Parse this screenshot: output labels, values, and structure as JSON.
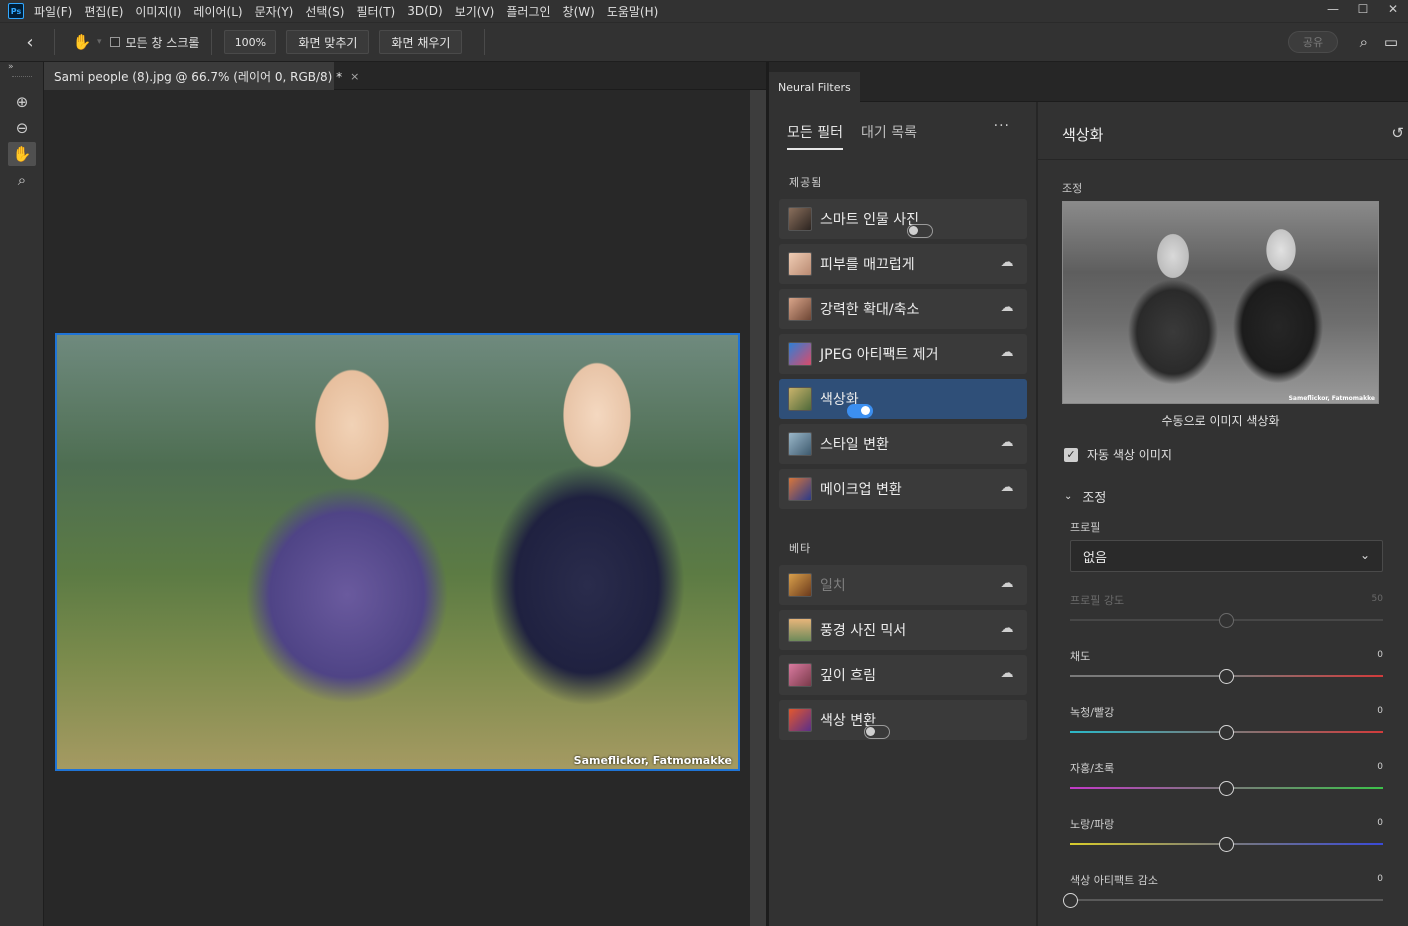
{
  "menubar": {
    "logo": "Ps",
    "items": [
      "파일(F)",
      "편집(E)",
      "이미지(I)",
      "레이어(L)",
      "문자(Y)",
      "선택(S)",
      "필터(T)",
      "3D(D)",
      "보기(V)",
      "플러그인",
      "창(W)",
      "도움말(H)"
    ],
    "window_controls": [
      "—",
      "☐",
      "✕"
    ]
  },
  "options": {
    "back_icon": "chevron-left-icon",
    "scroll_all_windows": "모든 창 스크롤",
    "zoom": "100%",
    "fit_screen": "화면 맞추기",
    "fill_screen": "화면 채우기",
    "share": "공유"
  },
  "document": {
    "tab_title": "Sami people (8).jpg @ 66.7% (레이어 0, RGB/8) *",
    "close": "×",
    "watermark": "Sameflickor, Fatmomakke"
  },
  "neural_filters": {
    "panel_tab": "Neural Filters",
    "tabs": [
      "모든 필터",
      "대기 목록"
    ],
    "more": "···",
    "featured_title": "제공됨",
    "beta_title": "베타",
    "featured": [
      {
        "label": "스마트 인물 사진",
        "control": "toggle-off"
      },
      {
        "label": "피부를 매끄럽게",
        "control": "cloud"
      },
      {
        "label": "강력한 확대/축소",
        "control": "cloud"
      },
      {
        "label": "JPEG 아티팩트 제거",
        "control": "cloud"
      },
      {
        "label": "색상화",
        "control": "toggle-on"
      },
      {
        "label": "스타일 변환",
        "control": "cloud"
      },
      {
        "label": "메이크업 변환",
        "control": "cloud"
      }
    ],
    "beta": [
      {
        "label": "일치",
        "control": "cloud"
      },
      {
        "label": "풍경 사진 믹서",
        "control": "cloud"
      },
      {
        "label": "깊이 흐림",
        "control": "cloud"
      },
      {
        "label": "색상 변환",
        "control": "toggle-off"
      }
    ],
    "colors": {
      "selected": "#2f4f78",
      "toggle_on": "#3c8ff0"
    }
  },
  "detail": {
    "title": "색상화",
    "reset_icon": "reset-icon",
    "adjust_label": "조정",
    "preview_watermark": "Sameflickor, Fatmomakke",
    "preview_caption": "수동으로 이미지 색상화",
    "auto_color": "자동 색상 이미지",
    "adjust_section": "조정",
    "profile_label": "프로필",
    "profile_value": "없음",
    "sliders": [
      {
        "label": "프로필 강도",
        "value": "50",
        "fraction": 0.5,
        "disabled": true
      },
      {
        "label": "채도",
        "value": "0",
        "fraction": 0.5
      },
      {
        "label": "녹청/빨강",
        "value": "0",
        "fraction": 0.5
      },
      {
        "label": "자홍/초록",
        "value": "0",
        "fraction": 0.5
      },
      {
        "label": "노랑/파랑",
        "value": "0",
        "fraction": 0.5
      },
      {
        "label": "색상 아티팩트 감소",
        "value": "0",
        "fraction": 0.0
      }
    ]
  }
}
